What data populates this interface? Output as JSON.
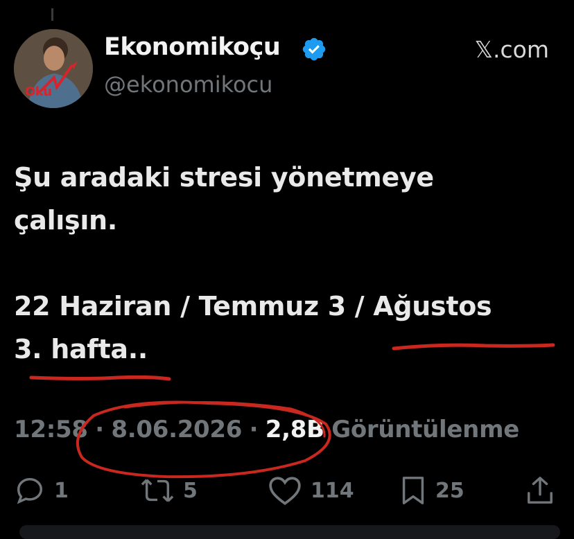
{
  "author": {
    "display_name": "Ekonomikoçu",
    "handle": "@ekonomikocu",
    "avatar_text": "Oku"
  },
  "source": "𝕏.com",
  "tweet": {
    "text": "Şu aradaki stresi yönetmeye\nçalışın.\n\n22 Haziran / Temmuz 3 / Ağustos\n3. hafta.."
  },
  "meta": {
    "time": "12:58",
    "date": "8.06.2026",
    "views": "2,8B",
    "views_label": "Görüntülenme",
    "separator": "·"
  },
  "actions": {
    "reply_count": "1",
    "retweet_count": "5",
    "like_count": "114",
    "bookmark_count": "25"
  },
  "colors": {
    "background": "#000000",
    "verified": "#1d9bf0",
    "annotation": "#c8281f",
    "muted": "#71767b"
  },
  "icons": {
    "verified": "verified-badge-icon",
    "reply": "reply-icon",
    "retweet": "retweet-icon",
    "like": "like-icon",
    "bookmark": "bookmark-icon",
    "share": "share-icon"
  }
}
